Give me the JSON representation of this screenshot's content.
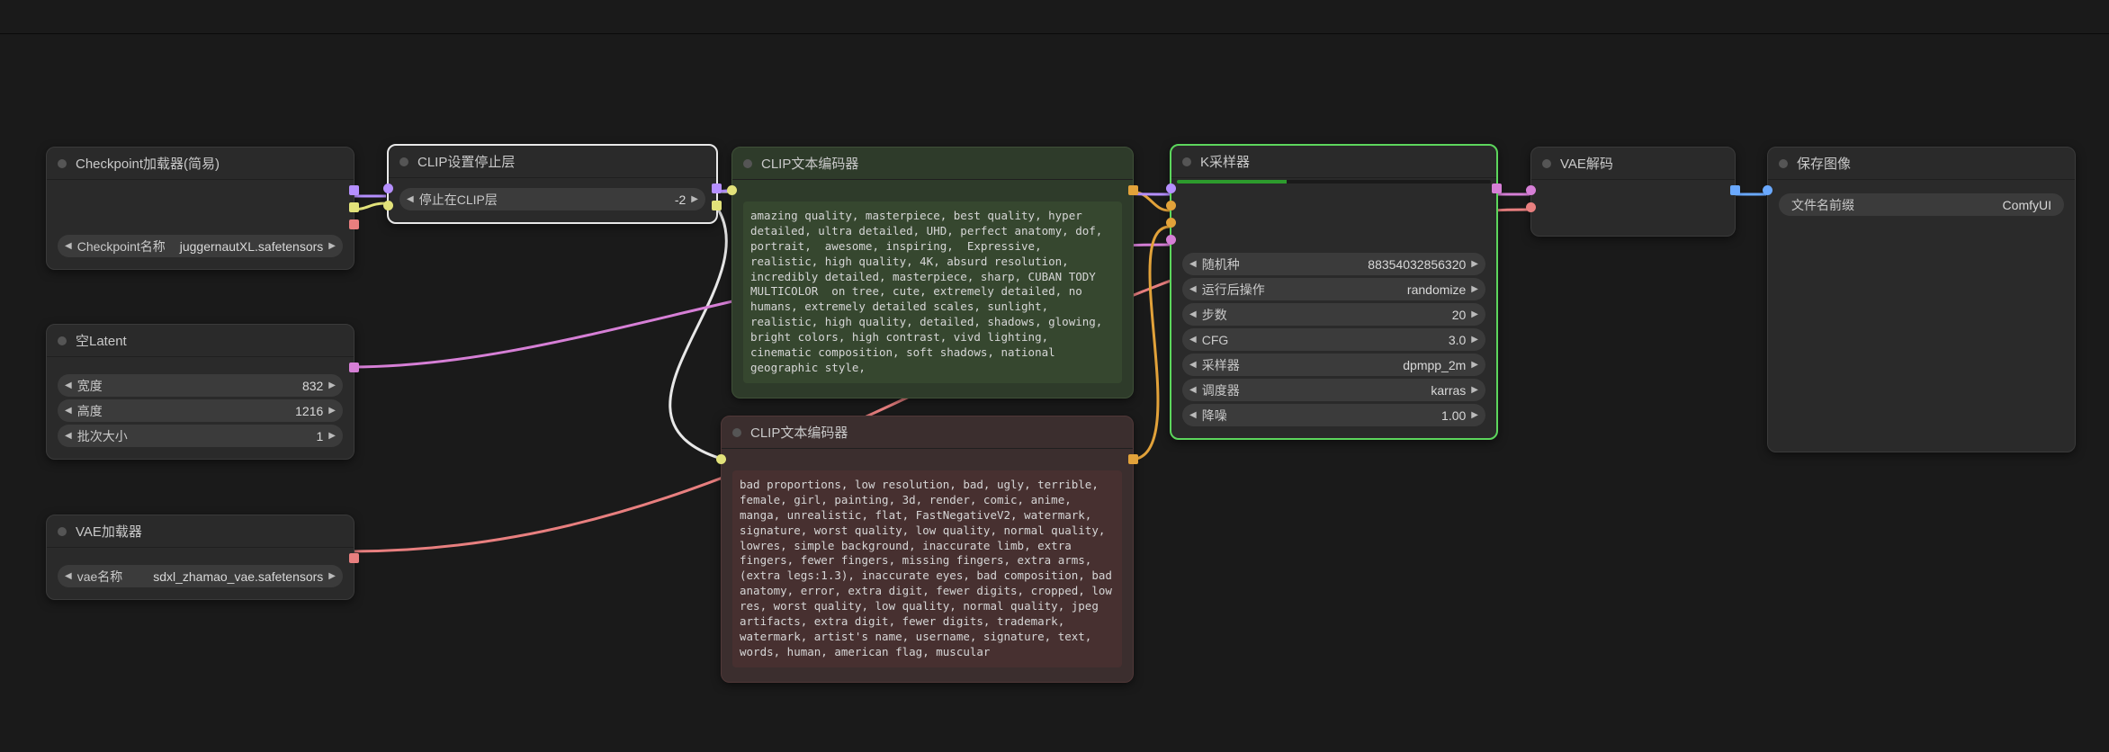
{
  "nodes": {
    "checkpoint": {
      "title": "Checkpoint加载器(简易)",
      "widget": {
        "label": "Checkpoint名称",
        "value": "juggernautXL.safetensors"
      }
    },
    "clipStop": {
      "title": "CLIP设置停止层",
      "widget": {
        "label": "停止在CLIP层",
        "value": "-2"
      }
    },
    "latent": {
      "title": "空Latent",
      "width": {
        "label": "宽度",
        "value": "832"
      },
      "height": {
        "label": "高度",
        "value": "1216"
      },
      "batch": {
        "label": "批次大小",
        "value": "1"
      }
    },
    "vaeLoad": {
      "title": "VAE加载器",
      "widget": {
        "label": "vae名称",
        "value": "sdxl_zhamao_vae.safetensors"
      }
    },
    "posEnc": {
      "title": "CLIP文本编码器",
      "text": "amazing quality, masterpiece, best quality, hyper detailed, ultra detailed, UHD, perfect anatomy, dof, portrait,  awesome, inspiring,  Expressive, realistic, high quality, 4K, absurd resolution, incredibly detailed, masterpiece, sharp, CUBAN TODY MULTICOLOR  on tree, cute, extremely detailed, no humans, extremely detailed scales, sunlight, realistic, high quality, detailed, shadows, glowing, bright colors, high contrast, vivd lighting, cinematic composition, soft shadows, national geographic style,"
    },
    "negEnc": {
      "title": "CLIP文本编码器",
      "text": "bad proportions, low resolution, bad, ugly, terrible, female, girl, painting, 3d, render, comic, anime, manga, unrealistic, flat, FastNegativeV2, watermark, signature, worst quality, low quality, normal quality, lowres, simple background, inaccurate limb, extra fingers, fewer fingers, missing fingers, extra arms, (extra legs:1.3), inaccurate eyes, bad composition, bad anatomy, error, extra digit, fewer digits, cropped, low res, worst quality, low quality, normal quality, jpeg artifacts, extra digit, fewer digits, trademark, watermark, artist's name, username, signature, text, words, human, american flag, muscular"
    },
    "ksampler": {
      "title": "K采样器",
      "progress_pct": 35,
      "seed": {
        "label": "随机种",
        "value": "88354032856320"
      },
      "afterRun": {
        "label": "运行后操作",
        "value": "randomize"
      },
      "steps": {
        "label": "步数",
        "value": "20"
      },
      "cfg": {
        "label": "CFG",
        "value": "3.0"
      },
      "sampler": {
        "label": "采样器",
        "value": "dpmpp_2m"
      },
      "scheduler": {
        "label": "调度器",
        "value": "karras"
      },
      "denoise": {
        "label": "降噪",
        "value": "1.00"
      }
    },
    "vaeDecode": {
      "title": "VAE解码"
    },
    "saveImage": {
      "title": "保存图像",
      "widget": {
        "label": "文件名前缀",
        "value": "ComfyUI"
      }
    }
  },
  "colors": {
    "model": "#b58fff",
    "clip": "#e2e27a",
    "vae": "#e87f7f",
    "latent": "#d67fd6",
    "cond": "#e2a23a",
    "image": "#6aa9ff"
  }
}
